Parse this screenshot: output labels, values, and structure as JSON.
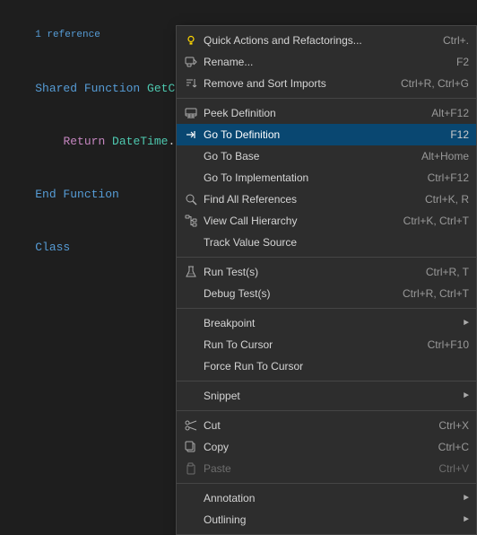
{
  "editor": {
    "ref_hint": "1 reference",
    "lines": [
      {
        "text": "Shared Function GetCurrentDate() As Date",
        "tokens": [
          "shared_fn",
          "name_getcurrent"
        ]
      },
      {
        "text": "    Return DateTime.Now",
        "tokens": [
          "return",
          "datetime"
        ]
      },
      {
        "text": "End Function",
        "tokens": [
          "end_fn"
        ]
      },
      {
        "text": "Class",
        "tokens": [
          "class"
        ]
      }
    ]
  },
  "context_menu": {
    "items": [
      {
        "id": "quick-actions",
        "label": "Quick Actions and Refactorings...",
        "shortcut": "Ctrl+.",
        "icon": "lightbulb",
        "has_arrow": false,
        "disabled": false,
        "separator_after": false
      },
      {
        "id": "rename",
        "label": "Rename...",
        "shortcut": "F2",
        "icon": "rename",
        "has_arrow": false,
        "disabled": false,
        "separator_after": false
      },
      {
        "id": "remove-sort-imports",
        "label": "Remove and Sort Imports",
        "shortcut": "Ctrl+R, Ctrl+G",
        "icon": "sort",
        "has_arrow": false,
        "disabled": false,
        "separator_after": true
      },
      {
        "id": "peek-definition",
        "label": "Peek Definition",
        "shortcut": "Alt+F12",
        "icon": "peek",
        "has_arrow": false,
        "disabled": false,
        "separator_after": false
      },
      {
        "id": "go-to-definition",
        "label": "Go To Definition",
        "shortcut": "F12",
        "icon": "goto",
        "has_arrow": false,
        "disabled": false,
        "active": true,
        "separator_after": false
      },
      {
        "id": "go-to-base",
        "label": "Go To Base",
        "shortcut": "Alt+Home",
        "icon": "",
        "has_arrow": false,
        "disabled": false,
        "separator_after": false
      },
      {
        "id": "go-to-implementation",
        "label": "Go To Implementation",
        "shortcut": "Ctrl+F12",
        "icon": "",
        "has_arrow": false,
        "disabled": false,
        "separator_after": false
      },
      {
        "id": "find-all-references",
        "label": "Find All References",
        "shortcut": "Ctrl+K, R",
        "icon": "ref",
        "has_arrow": false,
        "disabled": false,
        "separator_after": false
      },
      {
        "id": "view-call-hierarchy",
        "label": "View Call Hierarchy",
        "shortcut": "Ctrl+K, Ctrl+T",
        "icon": "hierarchy",
        "has_arrow": false,
        "disabled": false,
        "separator_after": false
      },
      {
        "id": "track-value-source",
        "label": "Track Value Source",
        "shortcut": "",
        "icon": "",
        "has_arrow": false,
        "disabled": false,
        "separator_after": true
      },
      {
        "id": "run-tests",
        "label": "Run Test(s)",
        "shortcut": "Ctrl+R, T",
        "icon": "beaker",
        "has_arrow": false,
        "disabled": false,
        "separator_after": false
      },
      {
        "id": "debug-tests",
        "label": "Debug Test(s)",
        "shortcut": "Ctrl+R, Ctrl+T",
        "icon": "",
        "has_arrow": false,
        "disabled": false,
        "separator_after": true
      },
      {
        "id": "breakpoint",
        "label": "Breakpoint",
        "shortcut": "",
        "icon": "",
        "has_arrow": true,
        "disabled": false,
        "separator_after": false
      },
      {
        "id": "run-to-cursor",
        "label": "Run To Cursor",
        "shortcut": "Ctrl+F10",
        "icon": "",
        "has_arrow": false,
        "disabled": false,
        "separator_after": false
      },
      {
        "id": "force-run-to-cursor",
        "label": "Force Run To Cursor",
        "shortcut": "",
        "icon": "",
        "has_arrow": false,
        "disabled": false,
        "separator_after": true
      },
      {
        "id": "snippet",
        "label": "Snippet",
        "shortcut": "",
        "icon": "",
        "has_arrow": true,
        "disabled": false,
        "separator_after": true
      },
      {
        "id": "cut",
        "label": "Cut",
        "shortcut": "Ctrl+X",
        "icon": "scissors",
        "has_arrow": false,
        "disabled": false,
        "separator_after": false
      },
      {
        "id": "copy",
        "label": "Copy",
        "shortcut": "Ctrl+C",
        "icon": "copy",
        "has_arrow": false,
        "disabled": false,
        "separator_after": false
      },
      {
        "id": "paste",
        "label": "Paste",
        "shortcut": "Ctrl+V",
        "icon": "paste",
        "has_arrow": false,
        "disabled": true,
        "separator_after": true
      },
      {
        "id": "annotation",
        "label": "Annotation",
        "shortcut": "",
        "icon": "",
        "has_arrow": true,
        "disabled": false,
        "separator_after": false
      },
      {
        "id": "outlining",
        "label": "Outlining",
        "shortcut": "",
        "icon": "",
        "has_arrow": true,
        "disabled": false,
        "separator_after": false
      }
    ]
  }
}
